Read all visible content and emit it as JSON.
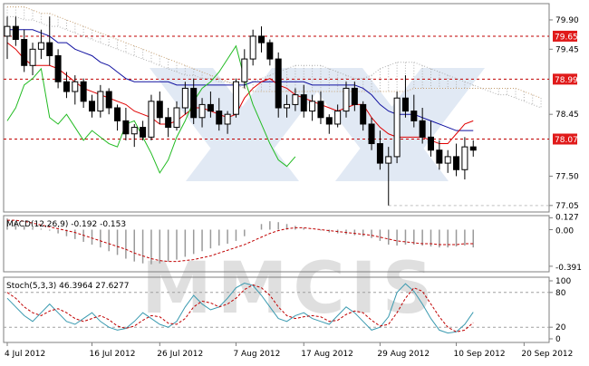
{
  "watermark": "MMCIS",
  "colors": {
    "background": "#ffffff",
    "frame": "#7f7f7f",
    "grid": "#c0c0c0",
    "candle": "#000000",
    "tenkan": "#e00000",
    "kijun": "#1010a0",
    "chikou": "#22bb22",
    "cloud": "#b0b0b0",
    "cloud_span_b": "#c8a070",
    "level_line": "#c00000",
    "level_badge": "#e01a1a",
    "macd_hist": "#9a9a9a",
    "macd_signal": "#c00000",
    "stoch_main": "#3a9ab0",
    "stoch_signal": "#c00000",
    "stoch_level": "#a0a0a0",
    "watermark": "#c9d8ec"
  },
  "x_axis": {
    "labels": [
      "4 Jul 2012",
      "16 Jul 2012",
      "26 Jul 2012",
      "7 Aug 2012",
      "17 Aug 2012",
      "29 Aug 2012",
      "10 Sep 2012",
      "20 Sep 2012"
    ],
    "label_index": [
      0,
      10,
      18,
      27,
      35,
      44,
      53,
      61
    ]
  },
  "main_axis": {
    "ticks": [
      "79.90",
      "79.45",
      "78.45",
      "77.50",
      "77.05"
    ],
    "tick_values": [
      79.9,
      79.45,
      78.45,
      77.5,
      77.05
    ],
    "range": [
      76.95,
      80.15
    ]
  },
  "levels": [
    {
      "label": "79.65",
      "value": 79.65
    },
    {
      "label": "78.99",
      "value": 78.99
    },
    {
      "label": "78.07",
      "value": 78.07
    }
  ],
  "macd": {
    "label": "MACD(12,26,9) -0.192 -0.153",
    "ticks": [
      "0.127",
      "0.00",
      "-0.391"
    ],
    "tick_values": [
      0.127,
      0.0,
      -0.391
    ],
    "range": [
      -0.45,
      0.15
    ]
  },
  "stoch": {
    "label": "Stoch(5,3,3) 46.3964 27.6277",
    "ticks": [
      "100",
      "80",
      "20",
      "0"
    ],
    "tick_values": [
      100,
      80,
      20,
      0
    ],
    "range": [
      0,
      100
    ]
  },
  "chart_data": {
    "type": "candlestick",
    "title": "",
    "panels": [
      "price",
      "MACD(12,26,9)",
      "Stoch(5,3,3)"
    ],
    "candles": [
      [
        79.65,
        79.95,
        79.3,
        79.8
      ],
      [
        79.8,
        79.95,
        79.5,
        79.6
      ],
      [
        79.6,
        79.75,
        79.1,
        79.2
      ],
      [
        79.2,
        79.55,
        79.05,
        79.45
      ],
      [
        79.45,
        79.75,
        79.3,
        79.55
      ],
      [
        79.55,
        79.95,
        79.2,
        79.35
      ],
      [
        79.35,
        79.45,
        78.85,
        78.95
      ],
      [
        78.95,
        79.1,
        78.7,
        78.8
      ],
      [
        78.8,
        79.05,
        78.6,
        78.95
      ],
      [
        78.95,
        79.0,
        78.55,
        78.65
      ],
      [
        78.65,
        78.75,
        78.4,
        78.5
      ],
      [
        78.5,
        78.9,
        78.4,
        78.8
      ],
      [
        78.8,
        78.85,
        78.45,
        78.55
      ],
      [
        78.55,
        78.6,
        78.2,
        78.35
      ],
      [
        78.35,
        78.55,
        78.05,
        78.15
      ],
      [
        78.15,
        78.3,
        77.95,
        78.25
      ],
      [
        78.25,
        78.35,
        78.05,
        78.1
      ],
      [
        78.1,
        78.75,
        78.05,
        78.65
      ],
      [
        78.65,
        78.8,
        78.3,
        78.4
      ],
      [
        78.4,
        78.55,
        78.1,
        78.25
      ],
      [
        78.25,
        78.65,
        78.2,
        78.55
      ],
      [
        78.55,
        78.95,
        78.45,
        78.85
      ],
      [
        78.85,
        79.0,
        78.3,
        78.4
      ],
      [
        78.4,
        78.7,
        78.25,
        78.6
      ],
      [
        78.6,
        78.8,
        78.4,
        78.5
      ],
      [
        78.5,
        78.7,
        78.2,
        78.3
      ],
      [
        78.3,
        78.5,
        78.15,
        78.45
      ],
      [
        78.45,
        79.0,
        78.4,
        78.95
      ],
      [
        78.95,
        79.45,
        78.85,
        79.3
      ],
      [
        79.3,
        79.75,
        79.2,
        79.65
      ],
      [
        79.65,
        79.8,
        79.4,
        79.55
      ],
      [
        79.55,
        79.6,
        79.2,
        79.3
      ],
      [
        79.3,
        79.4,
        78.4,
        78.55
      ],
      [
        78.55,
        78.75,
        78.4,
        78.6
      ],
      [
        78.6,
        78.85,
        78.5,
        78.75
      ],
      [
        78.75,
        78.9,
        78.4,
        78.5
      ],
      [
        78.5,
        78.75,
        78.35,
        78.65
      ],
      [
        78.65,
        78.8,
        78.3,
        78.4
      ],
      [
        78.4,
        78.45,
        78.15,
        78.3
      ],
      [
        78.3,
        78.6,
        78.25,
        78.5
      ],
      [
        78.5,
        78.95,
        78.4,
        78.85
      ],
      [
        78.85,
        78.95,
        78.5,
        78.6
      ],
      [
        78.6,
        78.65,
        78.2,
        78.3
      ],
      [
        78.3,
        78.4,
        77.9,
        78.0
      ],
      [
        78.0,
        78.2,
        77.6,
        77.7
      ],
      [
        77.7,
        77.95,
        77.05,
        77.8
      ],
      [
        77.8,
        78.8,
        77.7,
        78.7
      ],
      [
        78.7,
        79.05,
        78.4,
        78.5
      ],
      [
        78.5,
        78.75,
        78.25,
        78.35
      ],
      [
        78.35,
        78.55,
        78.0,
        78.1
      ],
      [
        78.1,
        78.35,
        77.8,
        77.9
      ],
      [
        77.9,
        78.05,
        77.6,
        77.7
      ],
      [
        77.7,
        77.9,
        77.55,
        77.8
      ],
      [
        77.8,
        78.0,
        77.5,
        77.6
      ],
      [
        77.6,
        78.1,
        77.45,
        77.95
      ],
      [
        77.95,
        78.05,
        77.8,
        77.9
      ]
    ],
    "tenkan_sen": [
      79.55,
      79.45,
      79.3,
      79.2,
      79.2,
      79.2,
      79.15,
      79.05,
      78.95,
      78.85,
      78.8,
      78.75,
      78.7,
      78.65,
      78.6,
      78.5,
      78.45,
      78.4,
      78.3,
      78.3,
      78.35,
      78.45,
      78.55,
      78.55,
      78.5,
      78.45,
      78.4,
      78.45,
      78.7,
      78.85,
      78.95,
      79.0,
      78.9,
      78.85,
      78.75,
      78.7,
      78.65,
      78.6,
      78.55,
      78.5,
      78.55,
      78.6,
      78.6,
      78.4,
      78.25,
      78.15,
      78.1,
      78.1,
      78.1,
      78.1,
      78.05,
      78.0,
      78.0,
      78.15,
      78.3,
      78.35
    ],
    "kijun_sen": [
      79.75,
      79.75,
      79.75,
      79.75,
      79.7,
      79.65,
      79.55,
      79.55,
      79.45,
      79.4,
      79.35,
      79.25,
      79.2,
      79.1,
      79.0,
      78.95,
      78.95,
      78.95,
      78.95,
      78.95,
      78.9,
      78.9,
      78.9,
      78.9,
      78.9,
      78.9,
      78.9,
      78.9,
      78.9,
      78.95,
      78.95,
      78.95,
      78.95,
      78.95,
      78.95,
      78.95,
      78.9,
      78.9,
      78.9,
      78.9,
      78.9,
      78.9,
      78.85,
      78.75,
      78.6,
      78.5,
      78.45,
      78.45,
      78.45,
      78.4,
      78.35,
      78.3,
      78.25,
      78.2,
      78.2,
      78.2
    ],
    "chikou_span": [
      78.35,
      78.55,
      78.9,
      79.0,
      79.15,
      78.4,
      78.3,
      78.45,
      78.25,
      78.05,
      78.2,
      78.1,
      78.0,
      77.95,
      78.3,
      78.35,
      78.1,
      77.85,
      77.55,
      77.75,
      78.1,
      78.35,
      78.65,
      78.85,
      78.95,
      79.1,
      79.3,
      79.5,
      79.0,
      78.6,
      78.3,
      78.0,
      77.75,
      77.65,
      77.8
    ],
    "kumo_span_a": [
      79.95,
      79.95,
      79.9,
      79.9,
      79.85,
      79.8,
      79.8,
      79.75,
      79.7,
      79.65,
      79.6,
      79.55,
      79.5,
      79.45,
      79.4,
      79.35,
      79.3,
      79.25,
      79.2,
      79.15,
      79.1,
      79.05,
      79.05,
      79.0,
      79.0,
      78.95,
      78.95,
      78.9,
      78.9,
      78.95,
      79.0,
      79.05,
      79.1,
      79.15,
      79.2,
      79.2,
      79.2,
      79.2,
      79.15,
      79.1,
      79.05,
      79.0,
      79.0,
      79.05,
      79.15,
      79.2,
      79.25,
      79.25,
      79.25,
      79.2,
      79.15,
      79.1,
      79.05,
      79.0,
      78.95,
      78.9,
      78.85,
      78.8,
      78.75,
      78.75,
      78.7,
      78.65,
      78.6,
      78.55,
      78.5,
      78.45,
      78.4,
      78.35
    ],
    "kumo_span_b": [
      80.1,
      80.1,
      80.1,
      80.05,
      80.0,
      80.0,
      79.95,
      79.9,
      79.85,
      79.8,
      79.75,
      79.7,
      79.65,
      79.6,
      79.55,
      79.5,
      79.45,
      79.4,
      79.35,
      79.3,
      79.25,
      79.2,
      79.15,
      79.1,
      79.05,
      79.0,
      78.95,
      78.9,
      78.85,
      78.8,
      78.8,
      78.8,
      78.8,
      78.8,
      78.8,
      78.8,
      78.8,
      78.8,
      78.8,
      78.8,
      78.8,
      78.8,
      78.8,
      78.8,
      78.8,
      78.8,
      78.8,
      78.8,
      78.85,
      78.85,
      78.85,
      78.85,
      78.85,
      78.85,
      78.85,
      78.85,
      78.85,
      78.85,
      78.85,
      78.85,
      78.85,
      78.8,
      78.75,
      78.7,
      78.65,
      78.6,
      78.55,
      78.5
    ],
    "macd_hist": [
      0.12,
      0.08,
      0.04,
      0.02,
      0.01,
      -0.01,
      -0.04,
      -0.07,
      -0.1,
      -0.13,
      -0.16,
      -0.19,
      -0.23,
      -0.27,
      -0.31,
      -0.34,
      -0.36,
      -0.37,
      -0.36,
      -0.34,
      -0.32,
      -0.29,
      -0.26,
      -0.23,
      -0.2,
      -0.17,
      -0.15,
      -0.12,
      -0.07,
      0.0,
      0.06,
      0.09,
      0.08,
      0.06,
      0.04,
      0.02,
      0.0,
      -0.01,
      -0.03,
      -0.04,
      -0.05,
      -0.06,
      -0.07,
      -0.09,
      -0.12,
      -0.16,
      -0.17,
      -0.16,
      -0.16,
      -0.17,
      -0.18,
      -0.19,
      -0.19,
      -0.18,
      -0.17,
      -0.19
    ],
    "macd_signal": [
      0.1,
      0.1,
      0.09,
      0.07,
      0.05,
      0.03,
      0.01,
      -0.01,
      -0.03,
      -0.06,
      -0.09,
      -0.12,
      -0.15,
      -0.18,
      -0.21,
      -0.25,
      -0.28,
      -0.31,
      -0.33,
      -0.34,
      -0.34,
      -0.33,
      -0.32,
      -0.3,
      -0.28,
      -0.25,
      -0.22,
      -0.19,
      -0.16,
      -0.12,
      -0.08,
      -0.04,
      -0.01,
      0.01,
      0.02,
      0.02,
      0.01,
      0.0,
      -0.01,
      -0.02,
      -0.03,
      -0.04,
      -0.05,
      -0.06,
      -0.08,
      -0.1,
      -0.12,
      -0.13,
      -0.14,
      -0.15,
      -0.15,
      -0.16,
      -0.16,
      -0.16,
      -0.15,
      -0.15
    ],
    "stoch_main": [
      70,
      55,
      40,
      30,
      45,
      60,
      45,
      30,
      25,
      35,
      45,
      30,
      20,
      15,
      18,
      30,
      45,
      35,
      25,
      20,
      30,
      55,
      75,
      60,
      50,
      55,
      70,
      88,
      96,
      92,
      75,
      55,
      35,
      30,
      40,
      45,
      35,
      30,
      25,
      40,
      55,
      45,
      30,
      15,
      20,
      38,
      80,
      95,
      82,
      60,
      35,
      15,
      10,
      12,
      25,
      46
    ],
    "stoch_signal": [
      80,
      70,
      55,
      45,
      40,
      48,
      52,
      45,
      35,
      30,
      35,
      40,
      33,
      22,
      18,
      22,
      32,
      40,
      38,
      27,
      25,
      35,
      55,
      65,
      62,
      55,
      60,
      70,
      85,
      93,
      88,
      75,
      55,
      40,
      35,
      38,
      40,
      38,
      30,
      32,
      42,
      48,
      45,
      32,
      22,
      25,
      45,
      70,
      88,
      82,
      60,
      38,
      20,
      12,
      15,
      28
    ]
  }
}
